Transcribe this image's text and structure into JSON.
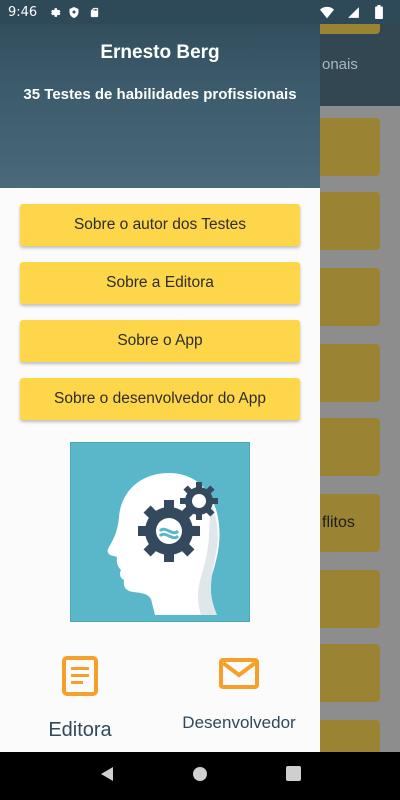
{
  "status_bar": {
    "time": "9:46",
    "left_icons": [
      "gear-icon",
      "shield-icon",
      "sd-card-icon"
    ],
    "right_icons": [
      "wifi-icon",
      "signal-icon",
      "battery-icon"
    ]
  },
  "background_app": {
    "toolbar_title_fragment": "onais",
    "card_text_fragment": "flitos"
  },
  "drawer": {
    "header": {
      "name": "Ernesto Berg",
      "subtitle": "35 Testes de habilidades profissionais"
    },
    "menu_items": [
      {
        "label": "Sobre o autor dos Testes"
      },
      {
        "label": "Sobre a Editora"
      },
      {
        "label": "Sobre o App"
      },
      {
        "label": "Sobre o desenvolvedor do App"
      }
    ],
    "logo_icon": "head-gears-icon",
    "bottom_actions": {
      "editora": {
        "label": "Editora",
        "icon": "document-icon"
      },
      "desenvolvedor": {
        "label": "Desenvolvedor",
        "icon": "mail-icon"
      }
    }
  },
  "colors": {
    "accent_yellow": "#fdd64a",
    "icon_orange": "#f5a02a",
    "header_dark": "#2f4a59",
    "logo_teal": "#5ab7c9"
  },
  "nav_bar": {
    "icons": [
      "back-icon",
      "home-icon",
      "recents-icon"
    ]
  }
}
